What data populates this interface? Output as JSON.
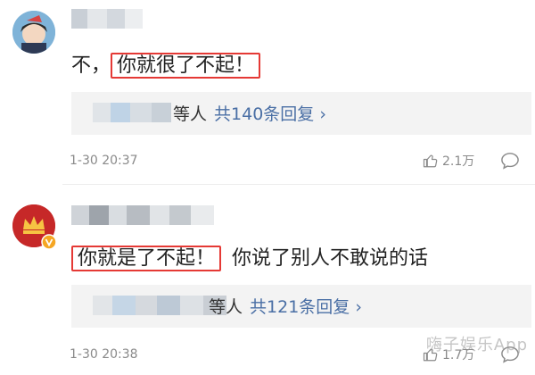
{
  "comments": [
    {
      "highlight": "你就很了不起！",
      "prefix": "不，",
      "rest": "",
      "replies_others": "等人",
      "replies_count": "共140条回复 ›",
      "time": "1-30 20:37",
      "likes": "2.1万"
    },
    {
      "highlight": "你就是了不起！",
      "prefix": "",
      "rest": "你说了别人不敢说的话",
      "replies_others": "等人",
      "replies_count": "共121条回复 ›",
      "time": "1-30 20:38",
      "likes": "1.7万"
    }
  ],
  "watermark": "嗨子娱乐App",
  "colors": {
    "highlight_border": "#e53935",
    "link": "#4a6fa5",
    "meta": "#8a8a8a"
  }
}
